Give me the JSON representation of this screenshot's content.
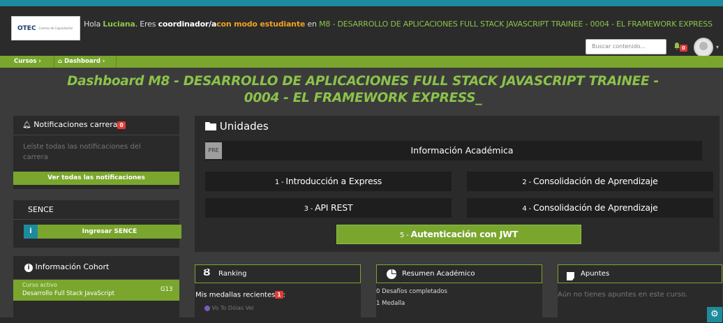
{
  "header": {
    "logo_text": "OTEC",
    "logo_small": "Centros de Capacitación",
    "greeting_prefix": "Hola ",
    "user_name": "Luciana",
    "greeting_mid": ". Eres ",
    "role": "coordinador/a",
    "mode": "con modo estudiante",
    "greeting_in": " en ",
    "course": "M8 - DESARROLLO DE APLICACIONES FULL STACK JAVASCRIPT TRAINEE - 0004 - EL FRAMEWORK EXPRESS",
    "search_placeholder": "Buscar contenido...",
    "notif_count": "0"
  },
  "breadcrumb": {
    "items": [
      "Cursos",
      "Dashboard"
    ]
  },
  "page_title": "Dashboard M8 - DESARROLLO DE APLICACIONES FULL STACK JAVASCRIPT TRAINEE - 0004 - EL FRAMEWORK EXPRESS_",
  "page_title_line1": "Dashboard M8 - DESARROLLO DE APLICACIONES FULL STACK JAVASCRIPT TRAINEE -",
  "page_title_line2": "0004 - EL FRAMEWORK EXPRESS_",
  "notifications": {
    "title": "Notificaciones carrera",
    "count": "0",
    "message": "Leíste todas las notificaciones del carrera",
    "button": "Ver todas las notificaciones"
  },
  "sence": {
    "title": "SENCE",
    "button": "Ingresar SENCE"
  },
  "cohort": {
    "title": "Información Cohort",
    "label": "Curso activo",
    "course_name": "Desarrollo Full Stack JavaScript",
    "code": "G13"
  },
  "unidades": {
    "title": "Unidades",
    "pre_tag": "PRE",
    "info_academica": "Información Académica",
    "units": [
      {
        "num": "1",
        "name": "Introducción a Express"
      },
      {
        "num": "2",
        "name": "Consolidación de Aprendizaje"
      },
      {
        "num": "3",
        "name": "API REST"
      },
      {
        "num": "4",
        "name": "Consolidación de Aprendizaje"
      },
      {
        "num": "5",
        "name": "Autenticación con JWT"
      }
    ]
  },
  "ranking": {
    "title": "Ranking",
    "medals_label": "Mis medallas recientes",
    "medals_count": "1",
    "medal_item": "Vo To Dóias Vel"
  },
  "resumen": {
    "title": "Resumen Académico",
    "desafios": "0 Desafíos completados",
    "medalla": "1 Medalla"
  },
  "apuntes": {
    "title": "Apuntes",
    "empty": "Aún no tienes apuntes en este curso."
  },
  "colors": {
    "accent_green": "#8bc34a",
    "button_green": "#7aa62e",
    "teal": "#1e8b9d",
    "badge_red": "#e53935"
  }
}
